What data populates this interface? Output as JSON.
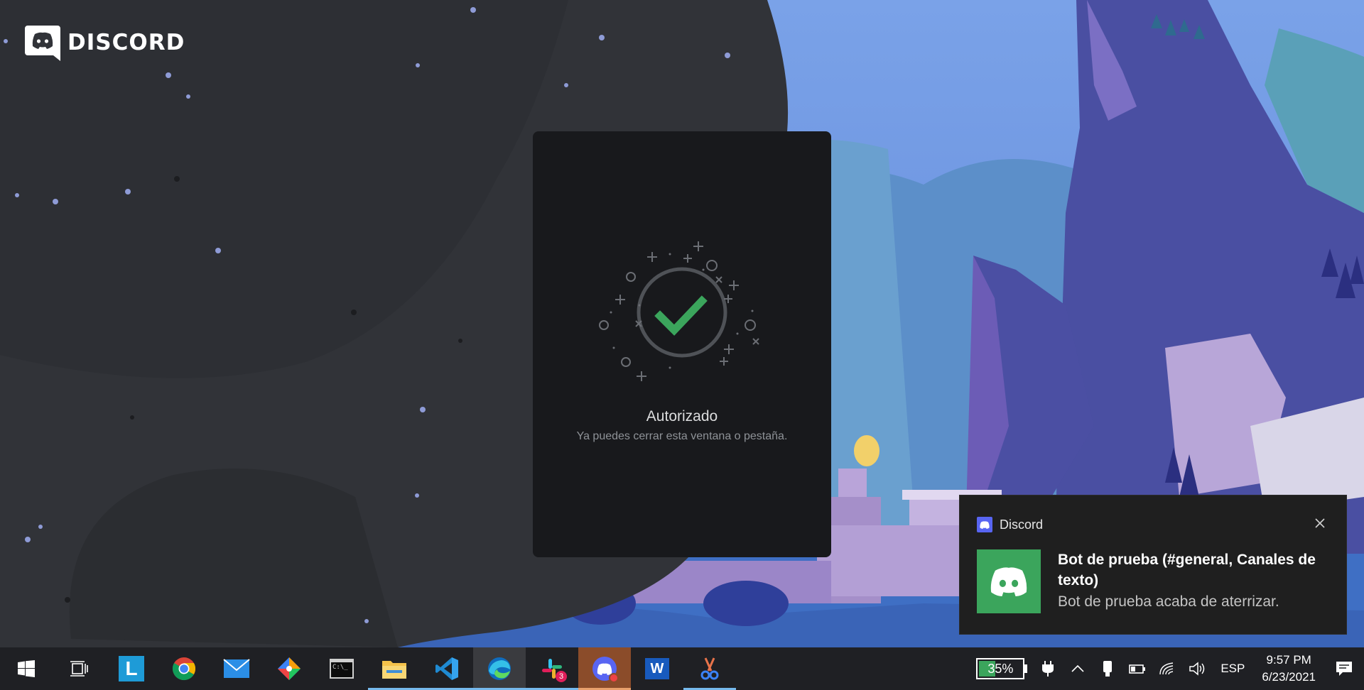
{
  "brand": {
    "name": "DISCORD",
    "icon": "discord-logo-icon"
  },
  "auth_card": {
    "title": "Autorizado",
    "subtitle": "Ya puedes cerrar esta ventana o pestaña.",
    "icon": "check-circle-icon",
    "accent": "#3ba55c"
  },
  "toast": {
    "app_name": "Discord",
    "title": "Bot de prueba (#general, Canales de texto)",
    "body": "Bot de prueba acaba de aterrizar.",
    "close_icon": "close-icon",
    "avatar_color": "#3ba55c"
  },
  "taskbar": {
    "apps": [
      {
        "name": "start-button",
        "icon": "windows-logo-icon"
      },
      {
        "name": "task-view-button",
        "icon": "task-view-icon"
      },
      {
        "name": "app-l",
        "icon": "l-app-icon",
        "label": "L"
      },
      {
        "name": "app-chrome",
        "icon": "chrome-icon"
      },
      {
        "name": "app-mail",
        "icon": "mail-icon"
      },
      {
        "name": "app-git",
        "icon": "git-client-icon"
      },
      {
        "name": "app-terminal",
        "icon": "terminal-icon",
        "label": "C:\\_"
      },
      {
        "name": "app-explorer",
        "icon": "folder-icon"
      },
      {
        "name": "app-vscode",
        "icon": "vscode-icon"
      },
      {
        "name": "app-edge",
        "icon": "edge-icon"
      },
      {
        "name": "app-slack",
        "icon": "slack-icon",
        "badge": "3"
      },
      {
        "name": "app-discord",
        "icon": "discord-icon"
      },
      {
        "name": "app-word",
        "icon": "word-icon",
        "label": "W"
      },
      {
        "name": "app-snip",
        "icon": "snip-icon"
      }
    ],
    "battery_percent": "35%",
    "battery_level": 0.35,
    "language": "ESP",
    "time": "9:57 PM",
    "date": "6/23/2021"
  }
}
